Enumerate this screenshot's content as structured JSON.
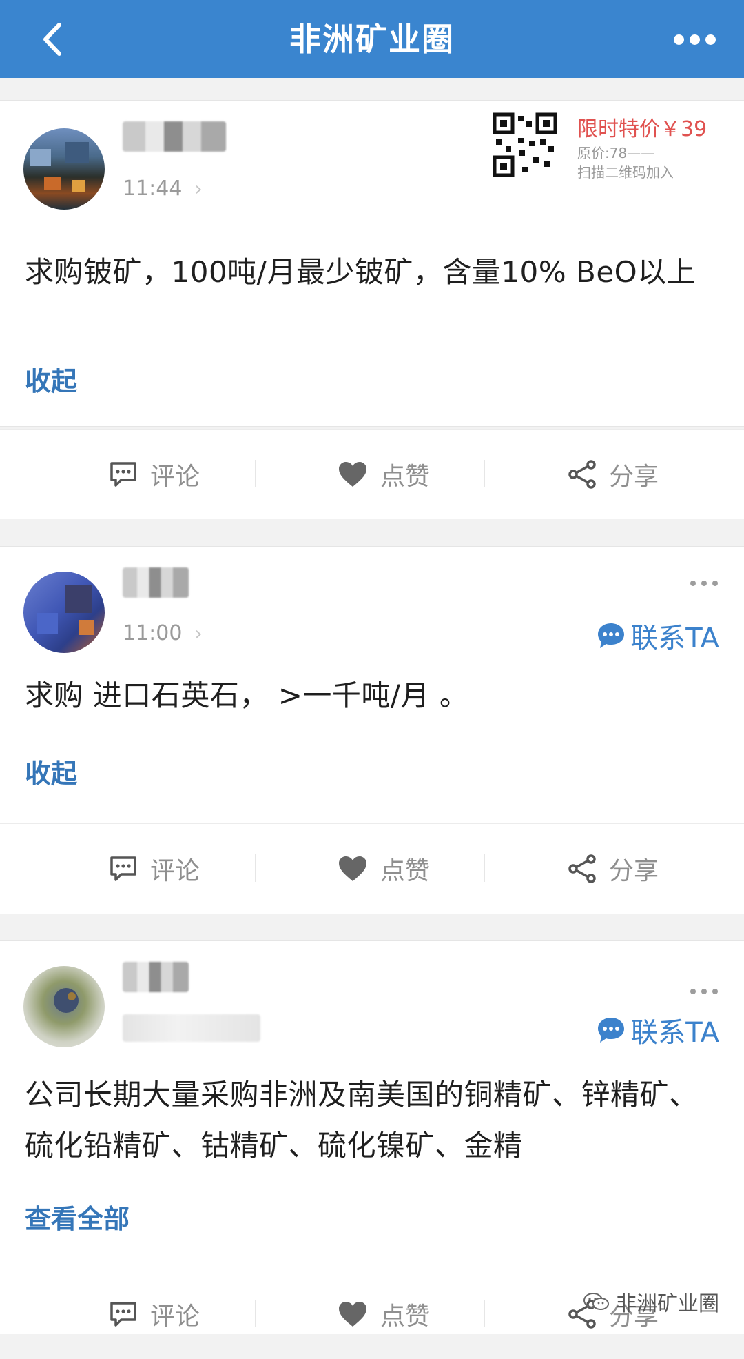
{
  "header": {
    "title": "非洲矿业圈"
  },
  "ad": {
    "price_label": "限时特价￥39",
    "original_price": "原价:78——",
    "scan_hint": "扫描二维码加入"
  },
  "posts": [
    {
      "time": "11:44",
      "text": "求购铍矿，100吨/月最少铍矿，含量10% BeO以上",
      "toggle_label": "收起"
    },
    {
      "time": "11:00",
      "contact_label": "联系TA",
      "text": "求购 进口石英石，  >一千吨/月 。",
      "toggle_label": "收起"
    },
    {
      "contact_label": "联系TA",
      "text": "公司长期大量采购非洲及南美国的铜精矿、锌精矿、硫化铅精矿、钴精矿、硫化镍矿、金精",
      "toggle_label": "查看全部"
    }
  ],
  "actions": {
    "comment_label": "评论",
    "like_label": "点赞",
    "share_label": "分享"
  },
  "watermark": {
    "text": "非洲矿业圈"
  },
  "colors": {
    "header_bg": "#3a85cf",
    "link": "#3576b8",
    "price": "#e05250"
  }
}
